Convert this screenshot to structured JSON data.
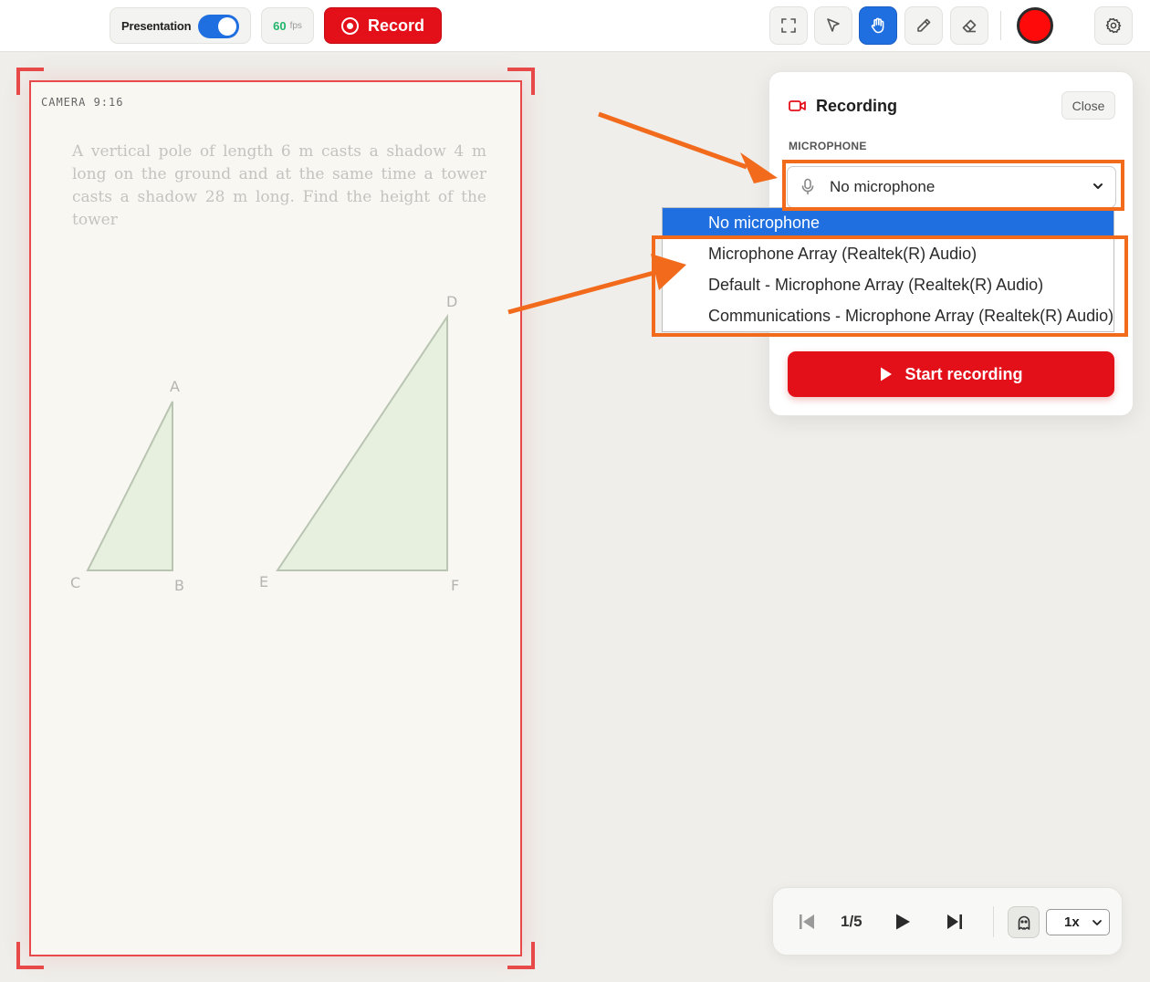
{
  "toolbar": {
    "presentation_label": "Presentation",
    "presentation_on": true,
    "fps_value": "60",
    "fps_unit": "fps",
    "record_label": "Record",
    "tools": [
      "fullscreen-icon",
      "cursor-icon",
      "hand-icon",
      "pen-icon",
      "eraser-icon"
    ],
    "active_tool": "hand-icon",
    "selected_color": "#ff0a0a"
  },
  "camera": {
    "label": "CAMERA 9:16",
    "problem_text": "A vertical pole of length 6 m casts a shadow 4 m long on the ground and at the same time a tower casts a shadow 28 m long. Find the height of the tower",
    "vertices": {
      "a": "A",
      "b": "B",
      "c": "C",
      "d": "D",
      "e": "E",
      "f": "F"
    }
  },
  "recording_panel": {
    "title": "Recording",
    "close_label": "Close",
    "mic_heading": "MICROPHONE",
    "mic_selected": "No microphone",
    "mic_options": [
      "No microphone",
      "Microphone Array (Realtek(R) Audio)",
      "Default - Microphone Array (Realtek(R) Audio)",
      "Communications - Microphone Array (Realtek(R) Audio)"
    ],
    "start_label": "Start recording"
  },
  "playback": {
    "page_indicator": "1/5",
    "speed": "1x"
  },
  "colors": {
    "accent_blue": "#1f6fe0",
    "record_red": "#e3101a",
    "annotation_orange": "#f26b1d",
    "frame_red": "#e84a4a"
  }
}
